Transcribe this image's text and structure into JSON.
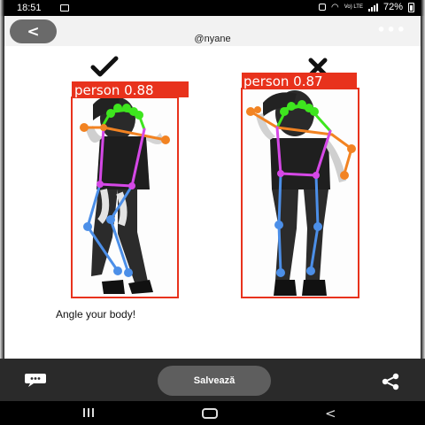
{
  "status_bar": {
    "time": "18:51",
    "battery": "72%",
    "network": "Vo) LTE"
  },
  "post": {
    "username": "@nyane",
    "caption": "Angle your body!",
    "examples": [
      {
        "mark": "check",
        "label": "person 0.88"
      },
      {
        "mark": "cross",
        "label": "person 0.87"
      }
    ]
  },
  "icons": {
    "back": "back-arrow-icon",
    "more": "more-icon",
    "comment": "comment-icon",
    "share": "share-icon"
  },
  "action_bar": {
    "save_label": "Salvează"
  },
  "colors": {
    "box": "#e8321c",
    "head": "#3ee51e",
    "arms": "#f28322",
    "torso": "#d548e6",
    "legs": "#4c8fe8"
  }
}
